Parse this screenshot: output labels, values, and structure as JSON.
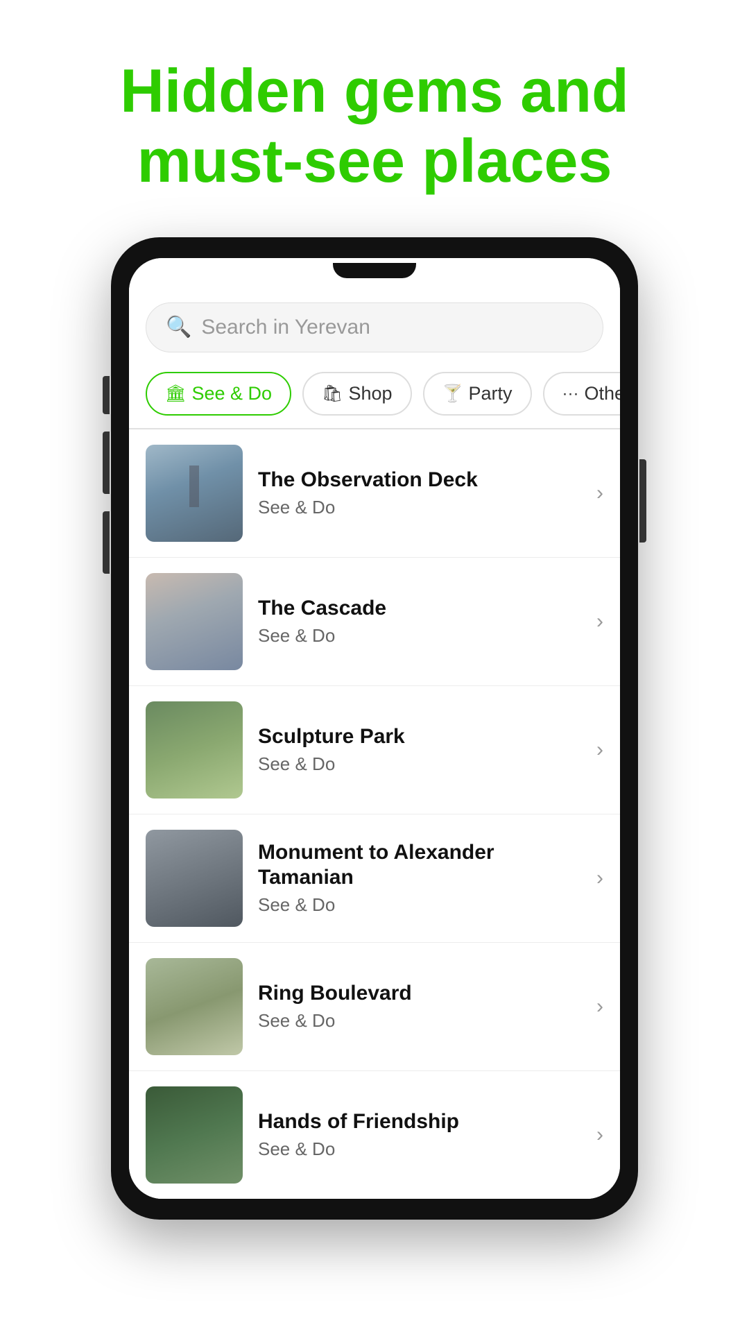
{
  "header": {
    "title": "Hidden gems and must-see places"
  },
  "search": {
    "placeholder": "Search in Yerevan"
  },
  "filter_tabs": [
    {
      "id": "see-do",
      "label": "See & Do",
      "icon": "🏛",
      "active": true
    },
    {
      "id": "shop",
      "label": "Shop",
      "icon": "🛍",
      "active": false
    },
    {
      "id": "party",
      "label": "Party",
      "icon": "🍸",
      "active": false
    },
    {
      "id": "other",
      "label": "Other",
      "icon": "···",
      "active": false
    }
  ],
  "places": [
    {
      "id": 1,
      "name": "The Observation Deck",
      "category": "See & Do",
      "thumb_class": "thumb-observation"
    },
    {
      "id": 2,
      "name": "The Cascade",
      "category": "See & Do",
      "thumb_class": "thumb-cascade"
    },
    {
      "id": 3,
      "name": "Sculpture Park",
      "category": "See & Do",
      "thumb_class": "thumb-sculpture"
    },
    {
      "id": 4,
      "name": "Monument to Alexander Tamanian",
      "category": "See & Do",
      "thumb_class": "thumb-monument"
    },
    {
      "id": 5,
      "name": "Ring Boulevard",
      "category": "See & Do",
      "thumb_class": "thumb-ring"
    },
    {
      "id": 6,
      "name": "Hands of Friendship",
      "category": "See & Do",
      "thumb_class": "thumb-hands"
    }
  ],
  "icons": {
    "search": "🔍",
    "chevron": "›"
  },
  "colors": {
    "green": "#2ecc00",
    "text_dark": "#111111",
    "text_gray": "#666666",
    "border": "#e0e0e0"
  }
}
